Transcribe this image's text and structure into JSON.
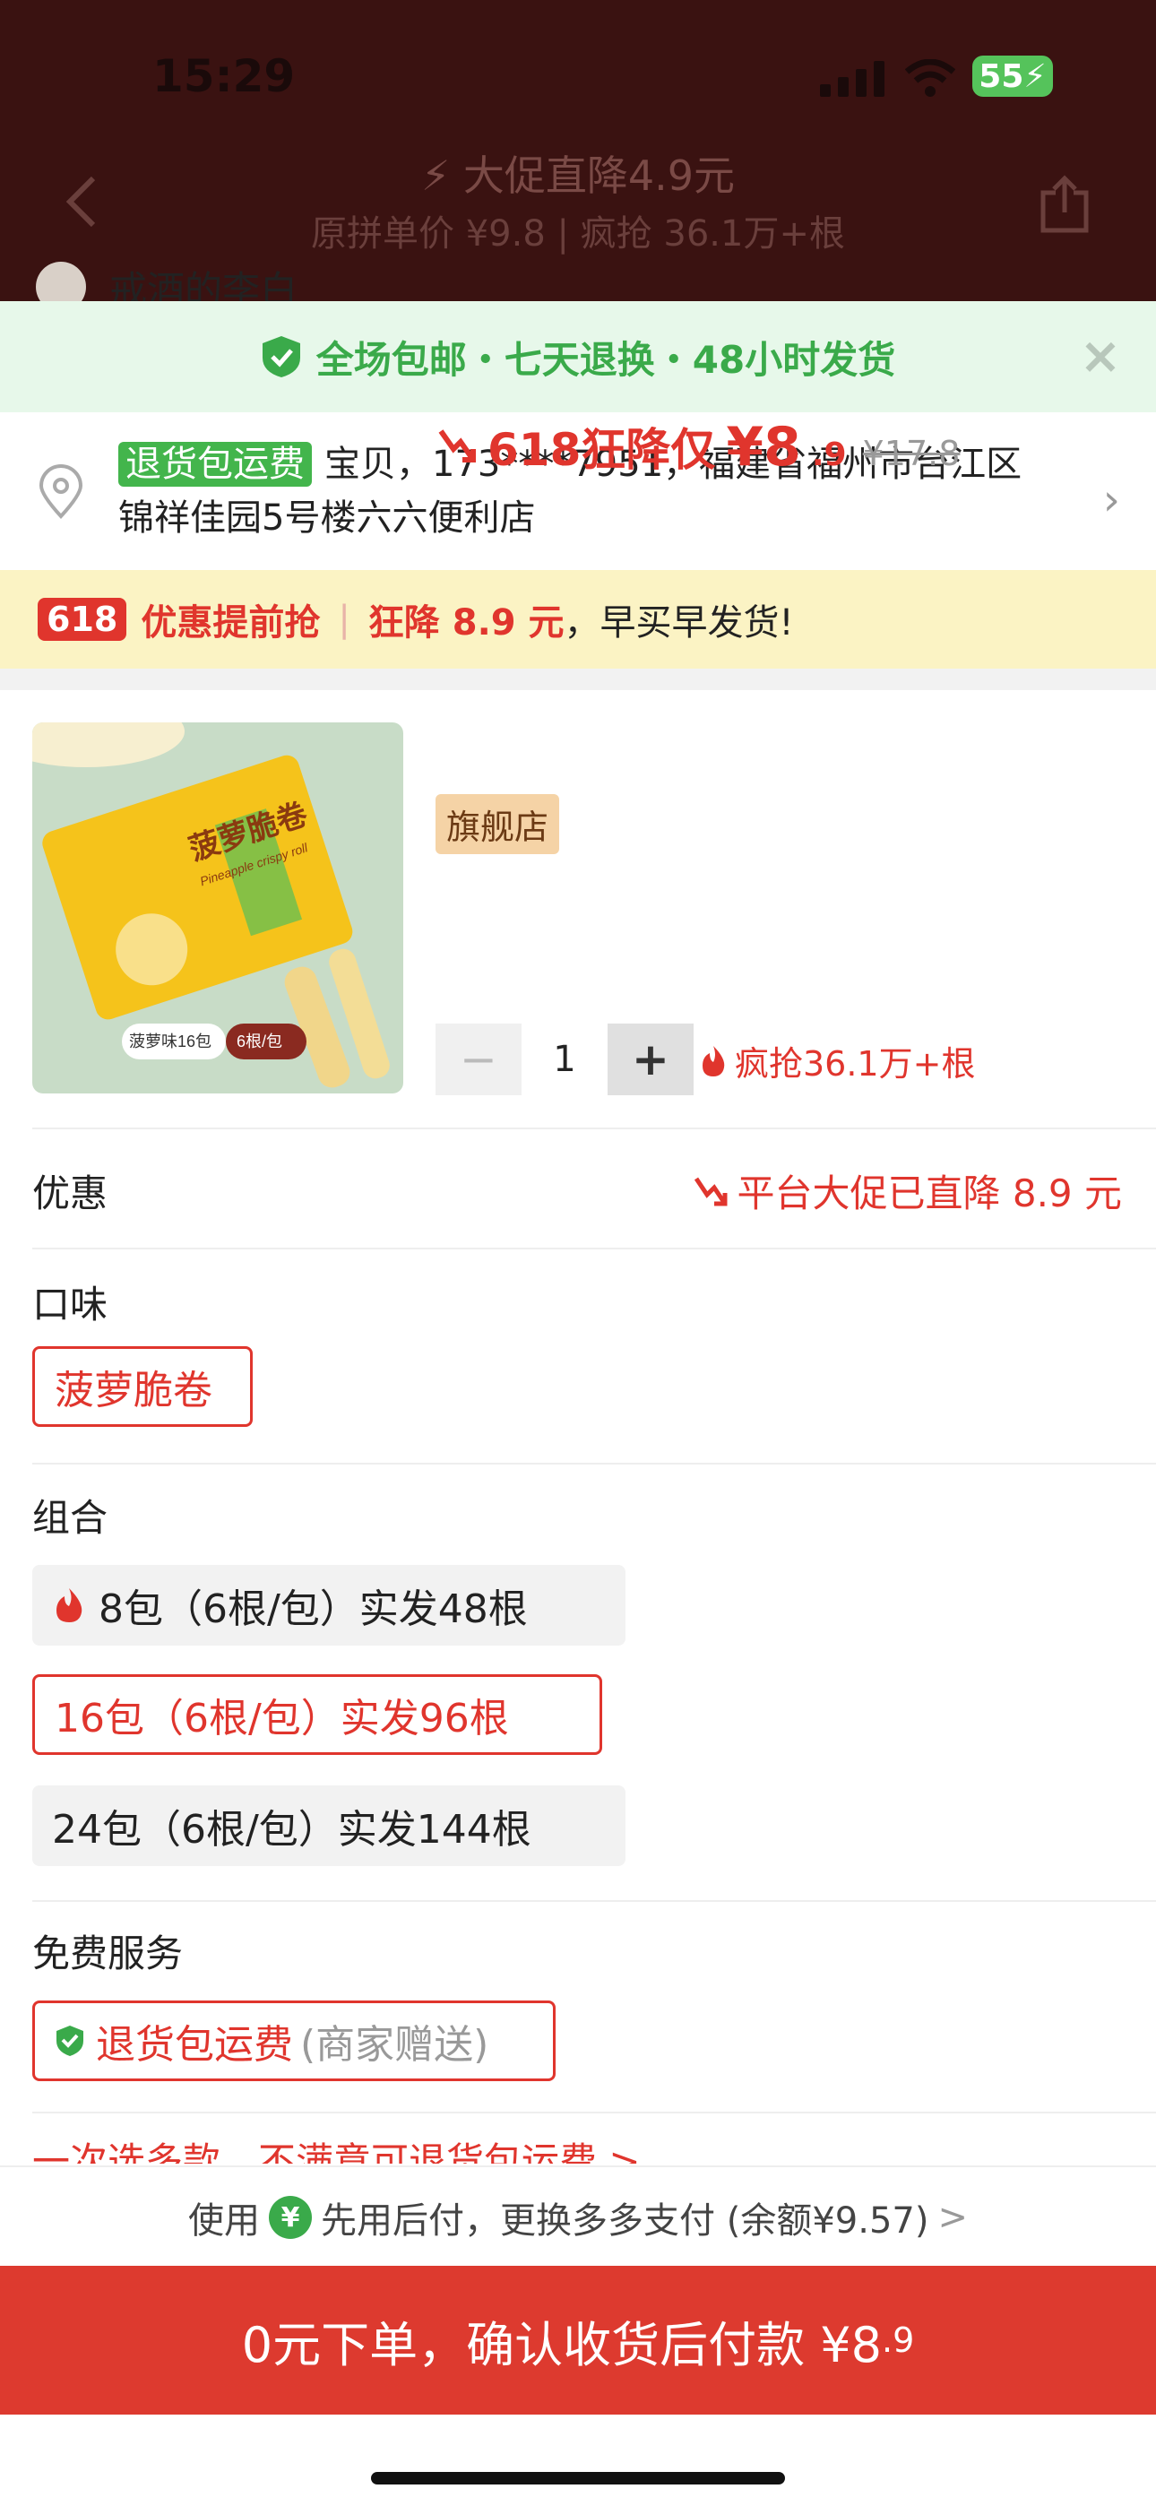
{
  "status_bar": {
    "time": "15:29",
    "battery": "55"
  },
  "nav": {
    "title": "⚡ 大促直降4.9元",
    "subtitle": "原拼单价 ¥9.8 | 疯抢 36.1万+根",
    "peek_user": "戒酒的李白"
  },
  "banner": {
    "text": "全场包邮・七天退换・48小时发货"
  },
  "address": {
    "tag": "退货包运费",
    "text": "宝贝，173****7951，福建省福州市台江区锦祥佳园5号楼六六便利店"
  },
  "promo": {
    "badge": "618",
    "label": "优惠提前抢",
    "sep": "|",
    "highlight": "狂降 8.9 元",
    "rest": "，早买早发货!"
  },
  "product": {
    "price_label": "618狂降仅",
    "price_big": "¥8",
    "price_small": ".9",
    "price_orig": "¥17.8",
    "store_tag": "旗舰店",
    "img_brand": "菠萝脆卷",
    "img_sub": "Pineapple crispy roll",
    "img_flavor": "菠萝味16包",
    "img_per": "6根/包",
    "qty": "1",
    "minus": "−",
    "plus": "+",
    "hot": "疯抢36.1万+根"
  },
  "discount": {
    "label": "优惠",
    "value": "平台大促已直降 8.9 元"
  },
  "flavor": {
    "label": "口味",
    "options": [
      "菠萝脆卷"
    ]
  },
  "combo": {
    "label": "组合",
    "options": [
      "8包（6根/包）实发48根",
      "16包（6根/包）实发96根",
      "24包（6根/包）实发144根"
    ]
  },
  "service": {
    "label": "免费服务",
    "tag_main": "退货包运费",
    "tag_sub": "(商家赠送)"
  },
  "peek_bottom": "一次选多款，不满意可退货包运费 >",
  "paybar": {
    "prefix": "使用",
    "text": "先用后付，更换多多支付 (余额¥9.57)",
    "arrow": ">"
  },
  "cta": {
    "main": "0元下单，确认收货后付款 ¥8",
    "small": ".9"
  },
  "colors": {
    "accent": "#e0352d",
    "green": "#3aaa4a"
  }
}
